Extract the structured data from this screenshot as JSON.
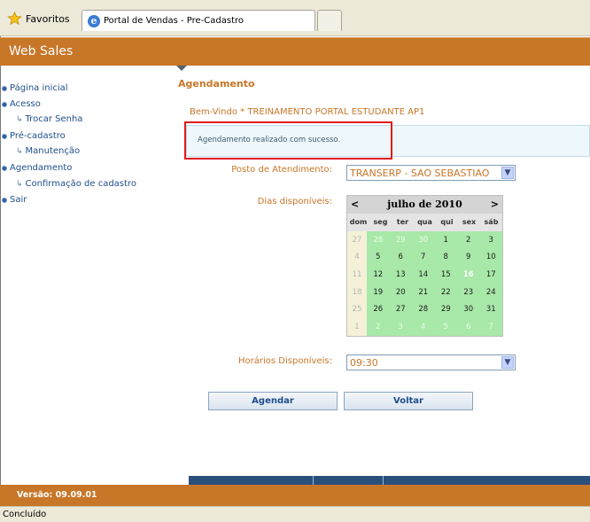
{
  "browser": {
    "favorites_label": "Favoritos",
    "tab_title": "Portal de Vendas - Pre-Cadastro",
    "status_text": "Concluído"
  },
  "app": {
    "title": "Web Sales",
    "version": "Versão: 09.09.01"
  },
  "sidebar": {
    "items": [
      {
        "label": "Página inicial"
      },
      {
        "label": "Acesso"
      },
      {
        "label": "Trocar Senha"
      },
      {
        "label": "Pré-cadastro"
      },
      {
        "label": "Manutenção"
      },
      {
        "label": "Agendamento"
      },
      {
        "label": "Confirmação de cadastro"
      },
      {
        "label": "Sair"
      }
    ]
  },
  "content": {
    "title": "Agendamento",
    "welcome": "Bem-Vindo * TREINAMENTO PORTAL ESTUDANTE AP1",
    "success_message": "Agendamento realizado com sucesso.",
    "posto_label": "Posto de Atendimento:",
    "posto_value": "TRANSERP - SAO SEBASTIAO",
    "dias_label": "Dias disponíveis:",
    "horarios_label": "Horários Disponíveis:",
    "horario_value": "09:30",
    "agendar_label": "Agendar",
    "voltar_label": "Voltar"
  },
  "calendar": {
    "prev": "<",
    "next": ">",
    "month_label": "julho de 2010",
    "weekdays": [
      "dom",
      "seg",
      "ter",
      "qua",
      "qui",
      "sex",
      "sáb"
    ],
    "weeks": [
      [
        "27",
        "28",
        "29",
        "30",
        "1",
        "2",
        "3"
      ],
      [
        "4",
        "5",
        "6",
        "7",
        "8",
        "9",
        "10"
      ],
      [
        "11",
        "12",
        "13",
        "14",
        "15",
        "16",
        "17"
      ],
      [
        "18",
        "19",
        "20",
        "21",
        "22",
        "23",
        "24"
      ],
      [
        "25",
        "26",
        "27",
        "28",
        "29",
        "30",
        "31"
      ],
      [
        "1",
        "2",
        "3",
        "4",
        "5",
        "6",
        "7"
      ]
    ],
    "today": "16"
  }
}
